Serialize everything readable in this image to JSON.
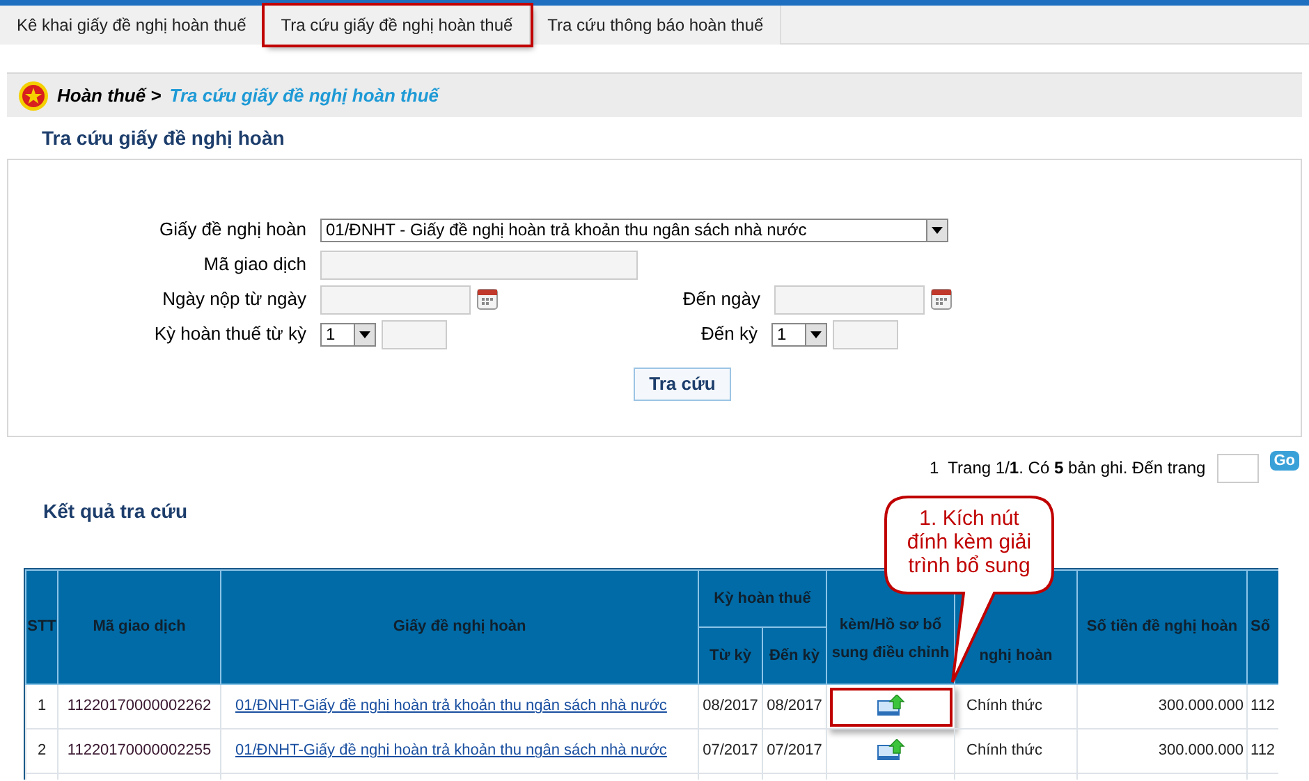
{
  "tabs": [
    {
      "label": "Kê khai giấy đề nghị hoàn thuế",
      "highlighted": false
    },
    {
      "label": "Tra cứu giấy đề nghị hoàn thuế",
      "highlighted": true
    },
    {
      "label": "Tra cứu thông báo hoàn thuế",
      "highlighted": false
    }
  ],
  "breadcrumb": {
    "root": "Hoàn thuế >",
    "current": "Tra cứu giấy đề nghị hoàn thuế"
  },
  "section_title": "Tra cứu giấy đề nghị hoàn",
  "form": {
    "rows": [
      {
        "kind": "select",
        "label": "Giấy đề nghị hoàn",
        "value": "01/ĐNHT - Giấy đề nghị hoàn trả khoản thu ngân sách nhà nước"
      },
      {
        "kind": "text",
        "label": "Mã giao dịch"
      },
      {
        "kind": "date_range",
        "label": "Ngày nộp từ ngày",
        "label_to": "Đến ngày"
      },
      {
        "kind": "period_range",
        "label": "Kỳ hoàn thuế từ kỳ",
        "from_value": "1",
        "label_to": "Đến kỳ",
        "to_value": "1"
      }
    ],
    "search_button": "Tra cứu"
  },
  "pagination": {
    "text": "1  Trang 1/**1**. Có **5** bản ghi. Đến trang",
    "go_button": "Go"
  },
  "results_title": "Kết quả tra cứu",
  "table": {
    "columns": [
      {
        "label": "STT"
      },
      {
        "label": "Mã giao dịch"
      },
      {
        "label": "Giấy đề nghị hoàn"
      },
      {
        "label": "Kỳ hoàn thuế",
        "children": [
          {
            "label": "Từ kỳ"
          },
          {
            "label": "Đến kỳ"
          }
        ]
      },
      {
        "label": "kèm/Hồ sơ bổ sung điều chỉnh"
      },
      {
        "label": "nghị hoàn"
      },
      {
        "label": "Số tiền đề nghị hoàn"
      },
      {
        "label": "Số"
      }
    ],
    "rows": [
      {
        "stt": "1",
        "code": "11220170000002262",
        "document": "01/ĐNHT-Giấy đề nghị hoàn trả khoản thu ngân sách nhà nước",
        "from": "08/2017",
        "to": "08/2017",
        "type": "Chính thức",
        "amount": "300.000.000",
        "column_9": "112",
        "highlighted": true
      },
      {
        "stt": "2",
        "code": "11220170000002255",
        "document": "01/ĐNHT-Giấy đề nghị hoàn trả khoản thu ngân sách nhà nước",
        "from": "07/2017",
        "to": "07/2017",
        "type": "Chính thức",
        "amount": "300.000.000",
        "column_9": "112",
        "highlighted": false
      }
    ]
  },
  "callout": {
    "text": "1. Kích nút đính kèm giải trình bổ sung"
  }
}
